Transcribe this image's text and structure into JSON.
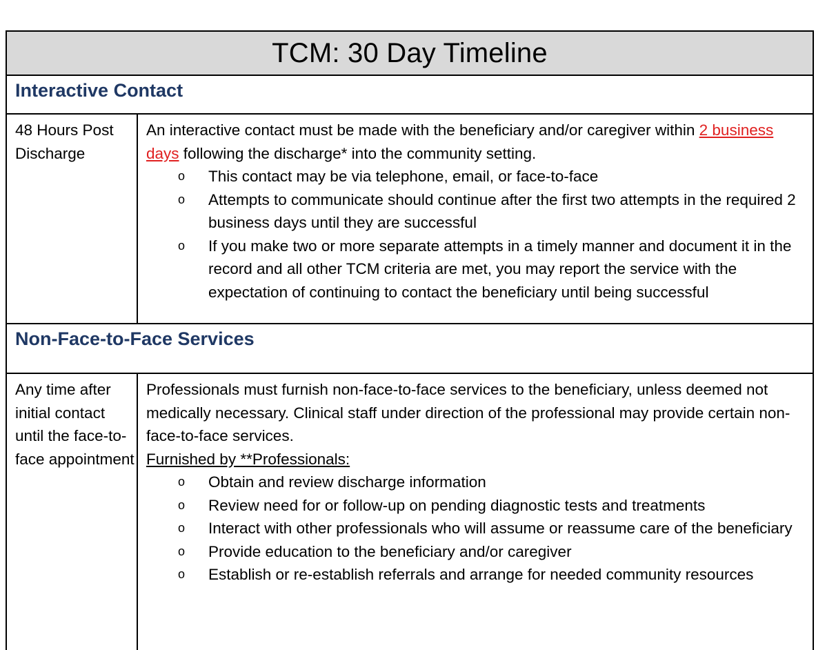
{
  "title": "TCM: 30 Day Timeline",
  "sections": [
    {
      "heading": "Interactive Contact",
      "timing": "48 Hours Post Discharge",
      "intro_before_link": "An interactive contact must be made with the beneficiary and/or caregiver within ",
      "intro_link": "2 business days",
      "intro_after_link": " following the discharge* into the community setting.",
      "bullets": [
        "This contact may be via telephone, email, or face-to-face",
        "Attempts to communicate should continue after the first two attempts in the required 2 business days until they are successful",
        "If you make two or more separate attempts in a timely manner and document it in the record and all other TCM criteria are met, you may report the service with the expectation of continuing to contact the beneficiary until being successful"
      ]
    },
    {
      "heading": "Non-Face-to-Face Services",
      "timing": "Any time after initial contact until the face-to-face appointment",
      "intro": "Professionals must furnish non-face-to-face services to the beneficiary, unless deemed not medically necessary. Clinical staff under direction of the professional may provide certain non-face-to-face services.",
      "subheading": "Furnished by **Professionals:",
      "bullets": [
        "Obtain and review discharge information",
        "Review need for or follow-up on pending diagnostic tests and treatments",
        "Interact with other professionals who will assume or reassume care of the beneficiary",
        "Provide education to the beneficiary and/or caregiver",
        "Establish or re-establish referrals and arrange for needed community resources"
      ]
    }
  ],
  "bullet_glyph": "o",
  "colors": {
    "title_bg": "#d9d9d9",
    "heading": "#1f3864",
    "link": "#e02020"
  }
}
